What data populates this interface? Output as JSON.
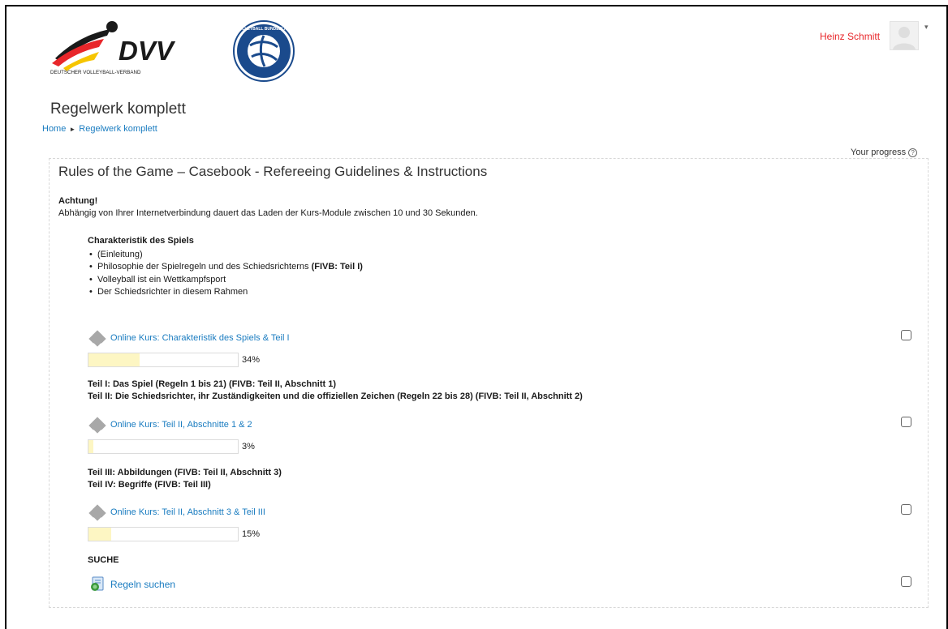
{
  "header": {
    "logo_dvv_text": "DVV",
    "logo_dvv_subtitle": "DEUTSCHER VOLLEYBALL-VERBAND",
    "logo_vbl_text": "VOLLEYBALL BUNDESLIGA",
    "user_name": "Heinz Schmitt"
  },
  "page": {
    "title": "Regelwerk komplett",
    "breadcrumb": [
      {
        "label": "Home"
      },
      {
        "label": "Regelwerk komplett"
      }
    ],
    "progress_label": "Your progress",
    "help_glyph": "?"
  },
  "section": {
    "title": "Rules of the Game – Casebook - Refereeing Guidelines & Instructions",
    "notice_heading": "Achtung!",
    "notice_text": "Abhängig von Ihrer Internetverbindung dauert das Laden der Kurs-Module zwischen 10 und 30 Sekunden.",
    "char_heading": "Charakteristik des Spiels",
    "char_items": [
      "(Einleitung)",
      "Philosophie der Spielregeln und des Schiedsrichterns",
      "Volleyball ist ein Wettkampfsport",
      "Der Schiedsrichter in diesem Rahmen"
    ],
    "char_item_bold": "(FIVB: Teil I)",
    "activities": [
      {
        "label": "Online Kurs: Charakteristik des Spiels & Teil I",
        "progress": 34,
        "progress_text": "34%",
        "icon": "scorm-icon"
      },
      {
        "label": "Online Kurs: Teil II, Abschnitte 1 & 2",
        "progress": 3,
        "progress_text": "3%",
        "icon": "scorm-icon"
      },
      {
        "label": "Online Kurs: Teil II, Abschnitt 3 & Teil III",
        "progress": 15,
        "progress_text": "15%",
        "icon": "scorm-icon"
      }
    ],
    "teil_lines_1": [
      "Teil I: Das Spiel (Regeln 1 bis 21) (FIVB: Teil II, Abschnitt 1)",
      "Teil II: Die Schiedsrichter, ihr Zuständigkeiten und die offiziellen Zeichen (Regeln 22 bis 28) (FIVB: Teil II, Abschnitt 2)"
    ],
    "teil_lines_2": [
      "Teil III: Abbildungen (FIVB: Teil II, Abschnitt 3)",
      "Teil IV: Begriffe (FIVB: Teil III)"
    ],
    "suche_heading": "SUCHE",
    "search_link": "Regeln suchen"
  },
  "colors": {
    "link": "#1a7cc0",
    "user_name": "#e8262a",
    "bar_fill": "#fdf6c3",
    "dvv_red": "#e8262a",
    "dvv_yellow": "#f6c500",
    "dvv_blue": "#1e4f9c",
    "vbl_blue": "#1a4a8c"
  }
}
